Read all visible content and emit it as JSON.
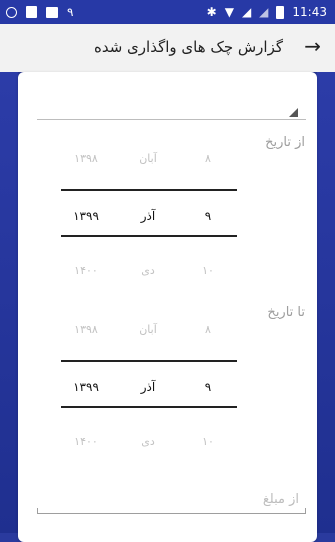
{
  "status_bar": {
    "time": "11:43",
    "left_number": "٩",
    "icons": [
      "circle-icon",
      "notes-icon",
      "image-icon",
      "bluetooth-icon",
      "wifi-icon",
      "signal-icon",
      "signal-weak-icon",
      "battery-icon"
    ]
  },
  "app_bar": {
    "title": "گزارش چک های واگذاری شده",
    "back_icon": "arrow-right-icon"
  },
  "form": {
    "from_date_label": "از تاریخ",
    "to_date_label": "تا تاریخ",
    "amount_label": "از مبلغ",
    "from_picker": {
      "prev": {
        "day": "۸",
        "month": "آبان",
        "year": "۱۳۹۸"
      },
      "selected": {
        "day": "۹",
        "month": "آذر",
        "year": "۱۳۹۹"
      },
      "next": {
        "day": "۱۰",
        "month": "دی",
        "year": "۱۴۰۰"
      }
    },
    "to_picker": {
      "prev": {
        "day": "۸",
        "month": "آبان",
        "year": "۱۳۹۸"
      },
      "selected": {
        "day": "۹",
        "month": "آذر",
        "year": "۱۳۹۹"
      },
      "next": {
        "day": "۱۰",
        "month": "دی",
        "year": "۱۴۰۰"
      }
    }
  },
  "colors": {
    "primary": "#2739a6",
    "appbar": "#f2f2f2",
    "divider": "#222222"
  }
}
